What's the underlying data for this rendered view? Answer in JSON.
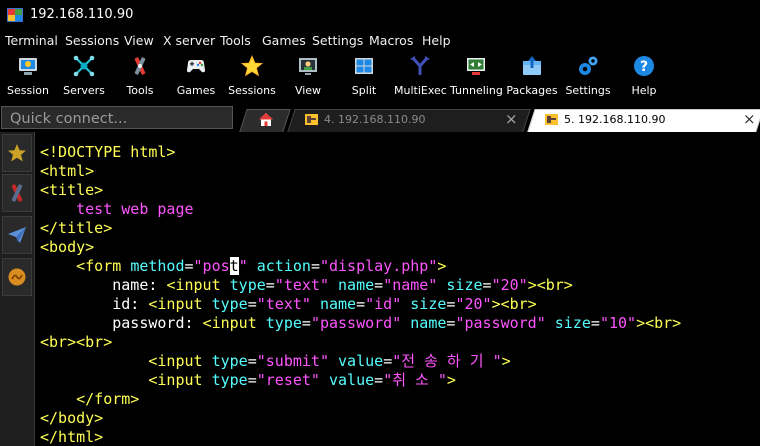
{
  "window": {
    "title": "192.168.110.90"
  },
  "menu": [
    "Terminal",
    "Sessions",
    "View",
    "X server",
    "Tools",
    "Games",
    "Settings",
    "Macros",
    "Help"
  ],
  "toolbar": [
    {
      "label": "Session",
      "icon": "session-icon"
    },
    {
      "label": "Servers",
      "icon": "servers-icon"
    },
    {
      "label": "Tools",
      "icon": "tools-icon"
    },
    {
      "label": "Games",
      "icon": "gamepad-icon"
    },
    {
      "label": "Sessions",
      "icon": "star-icon"
    },
    {
      "label": "View",
      "icon": "view-icon"
    },
    {
      "label": "Split",
      "icon": "split-icon"
    },
    {
      "label": "MultiExec",
      "icon": "multiexec-icon"
    },
    {
      "label": "Tunneling",
      "icon": "tunneling-icon"
    },
    {
      "label": "Packages",
      "icon": "packages-icon"
    },
    {
      "label": "Settings",
      "icon": "settings-icon"
    },
    {
      "label": "Help",
      "icon": "help-icon"
    }
  ],
  "quick_connect": {
    "placeholder": "Quick connect..."
  },
  "tabs": [
    {
      "label": "4. 192.168.110.90",
      "active": false,
      "close": "×"
    },
    {
      "label": "5. 192.168.110.90",
      "active": true,
      "close": "×"
    }
  ],
  "sidebar": [
    "favorites-star-icon",
    "tools-icon",
    "send-icon",
    "macros-icon"
  ],
  "code": [
    [
      [
        "tag",
        "<!DOCTYPE html>"
      ]
    ],
    [
      [
        "tag",
        "<html>"
      ]
    ],
    [
      [
        "tag",
        "<title>"
      ]
    ],
    [
      [
        "txt",
        "    "
      ],
      [
        "str",
        "test web page"
      ]
    ],
    [
      [
        "tag",
        "</title>"
      ]
    ],
    [
      [
        "tag",
        "<body>"
      ]
    ],
    [
      [
        "txt",
        "    "
      ],
      [
        "tag",
        "<form "
      ],
      [
        "attr",
        "method"
      ],
      [
        "txt",
        "="
      ],
      [
        "str",
        "\"pos"
      ],
      [
        "cursor",
        "t"
      ],
      [
        "str",
        "\""
      ],
      [
        "txt",
        " "
      ],
      [
        "attr",
        "action"
      ],
      [
        "txt",
        "="
      ],
      [
        "str",
        "\"display.php\""
      ],
      [
        "tag",
        ">"
      ]
    ],
    [
      [
        "txt",
        "        name: "
      ],
      [
        "tag",
        "<input "
      ],
      [
        "attr",
        "type"
      ],
      [
        "txt",
        "="
      ],
      [
        "str",
        "\"text\""
      ],
      [
        "txt",
        " "
      ],
      [
        "attr",
        "name"
      ],
      [
        "txt",
        "="
      ],
      [
        "str",
        "\"name\""
      ],
      [
        "txt",
        " "
      ],
      [
        "attr",
        "size"
      ],
      [
        "txt",
        "="
      ],
      [
        "str",
        "\"20\""
      ],
      [
        "tag",
        "><br>"
      ]
    ],
    [
      [
        "txt",
        "        id: "
      ],
      [
        "tag",
        "<input "
      ],
      [
        "attr",
        "type"
      ],
      [
        "txt",
        "="
      ],
      [
        "str",
        "\"text\""
      ],
      [
        "txt",
        " "
      ],
      [
        "attr",
        "name"
      ],
      [
        "txt",
        "="
      ],
      [
        "str",
        "\"id\""
      ],
      [
        "txt",
        " "
      ],
      [
        "attr",
        "size"
      ],
      [
        "txt",
        "="
      ],
      [
        "str",
        "\"20\""
      ],
      [
        "tag",
        "><br>"
      ]
    ],
    [
      [
        "txt",
        "        password: "
      ],
      [
        "tag",
        "<input "
      ],
      [
        "attr",
        "type"
      ],
      [
        "txt",
        "="
      ],
      [
        "str",
        "\"password\""
      ],
      [
        "txt",
        " "
      ],
      [
        "attr",
        "name"
      ],
      [
        "txt",
        "="
      ],
      [
        "str",
        "\"password\""
      ],
      [
        "txt",
        " "
      ],
      [
        "attr",
        "size"
      ],
      [
        "txt",
        "="
      ],
      [
        "str",
        "\"10\""
      ],
      [
        "tag",
        "><br>"
      ]
    ],
    [
      [
        "tag",
        "<br><br>"
      ]
    ],
    [
      [
        "txt",
        "            "
      ],
      [
        "tag",
        "<input "
      ],
      [
        "attr",
        "type"
      ],
      [
        "txt",
        "="
      ],
      [
        "str",
        "\"submit\""
      ],
      [
        "txt",
        " "
      ],
      [
        "attr",
        "value"
      ],
      [
        "txt",
        "="
      ],
      [
        "str",
        "\"전 송 하 기 \""
      ],
      [
        "tag",
        ">"
      ]
    ],
    [
      [
        "txt",
        "            "
      ],
      [
        "tag",
        "<input "
      ],
      [
        "attr",
        "type"
      ],
      [
        "txt",
        "="
      ],
      [
        "str",
        "\"reset\""
      ],
      [
        "txt",
        " "
      ],
      [
        "attr",
        "value"
      ],
      [
        "txt",
        "="
      ],
      [
        "str",
        "\"취 소 \""
      ],
      [
        "tag",
        ">"
      ]
    ],
    [
      [
        "txt",
        "    "
      ],
      [
        "tag",
        "</form>"
      ]
    ],
    [
      [
        "tag",
        "</body>"
      ]
    ],
    [
      [
        "tag",
        "</html>"
      ]
    ]
  ]
}
